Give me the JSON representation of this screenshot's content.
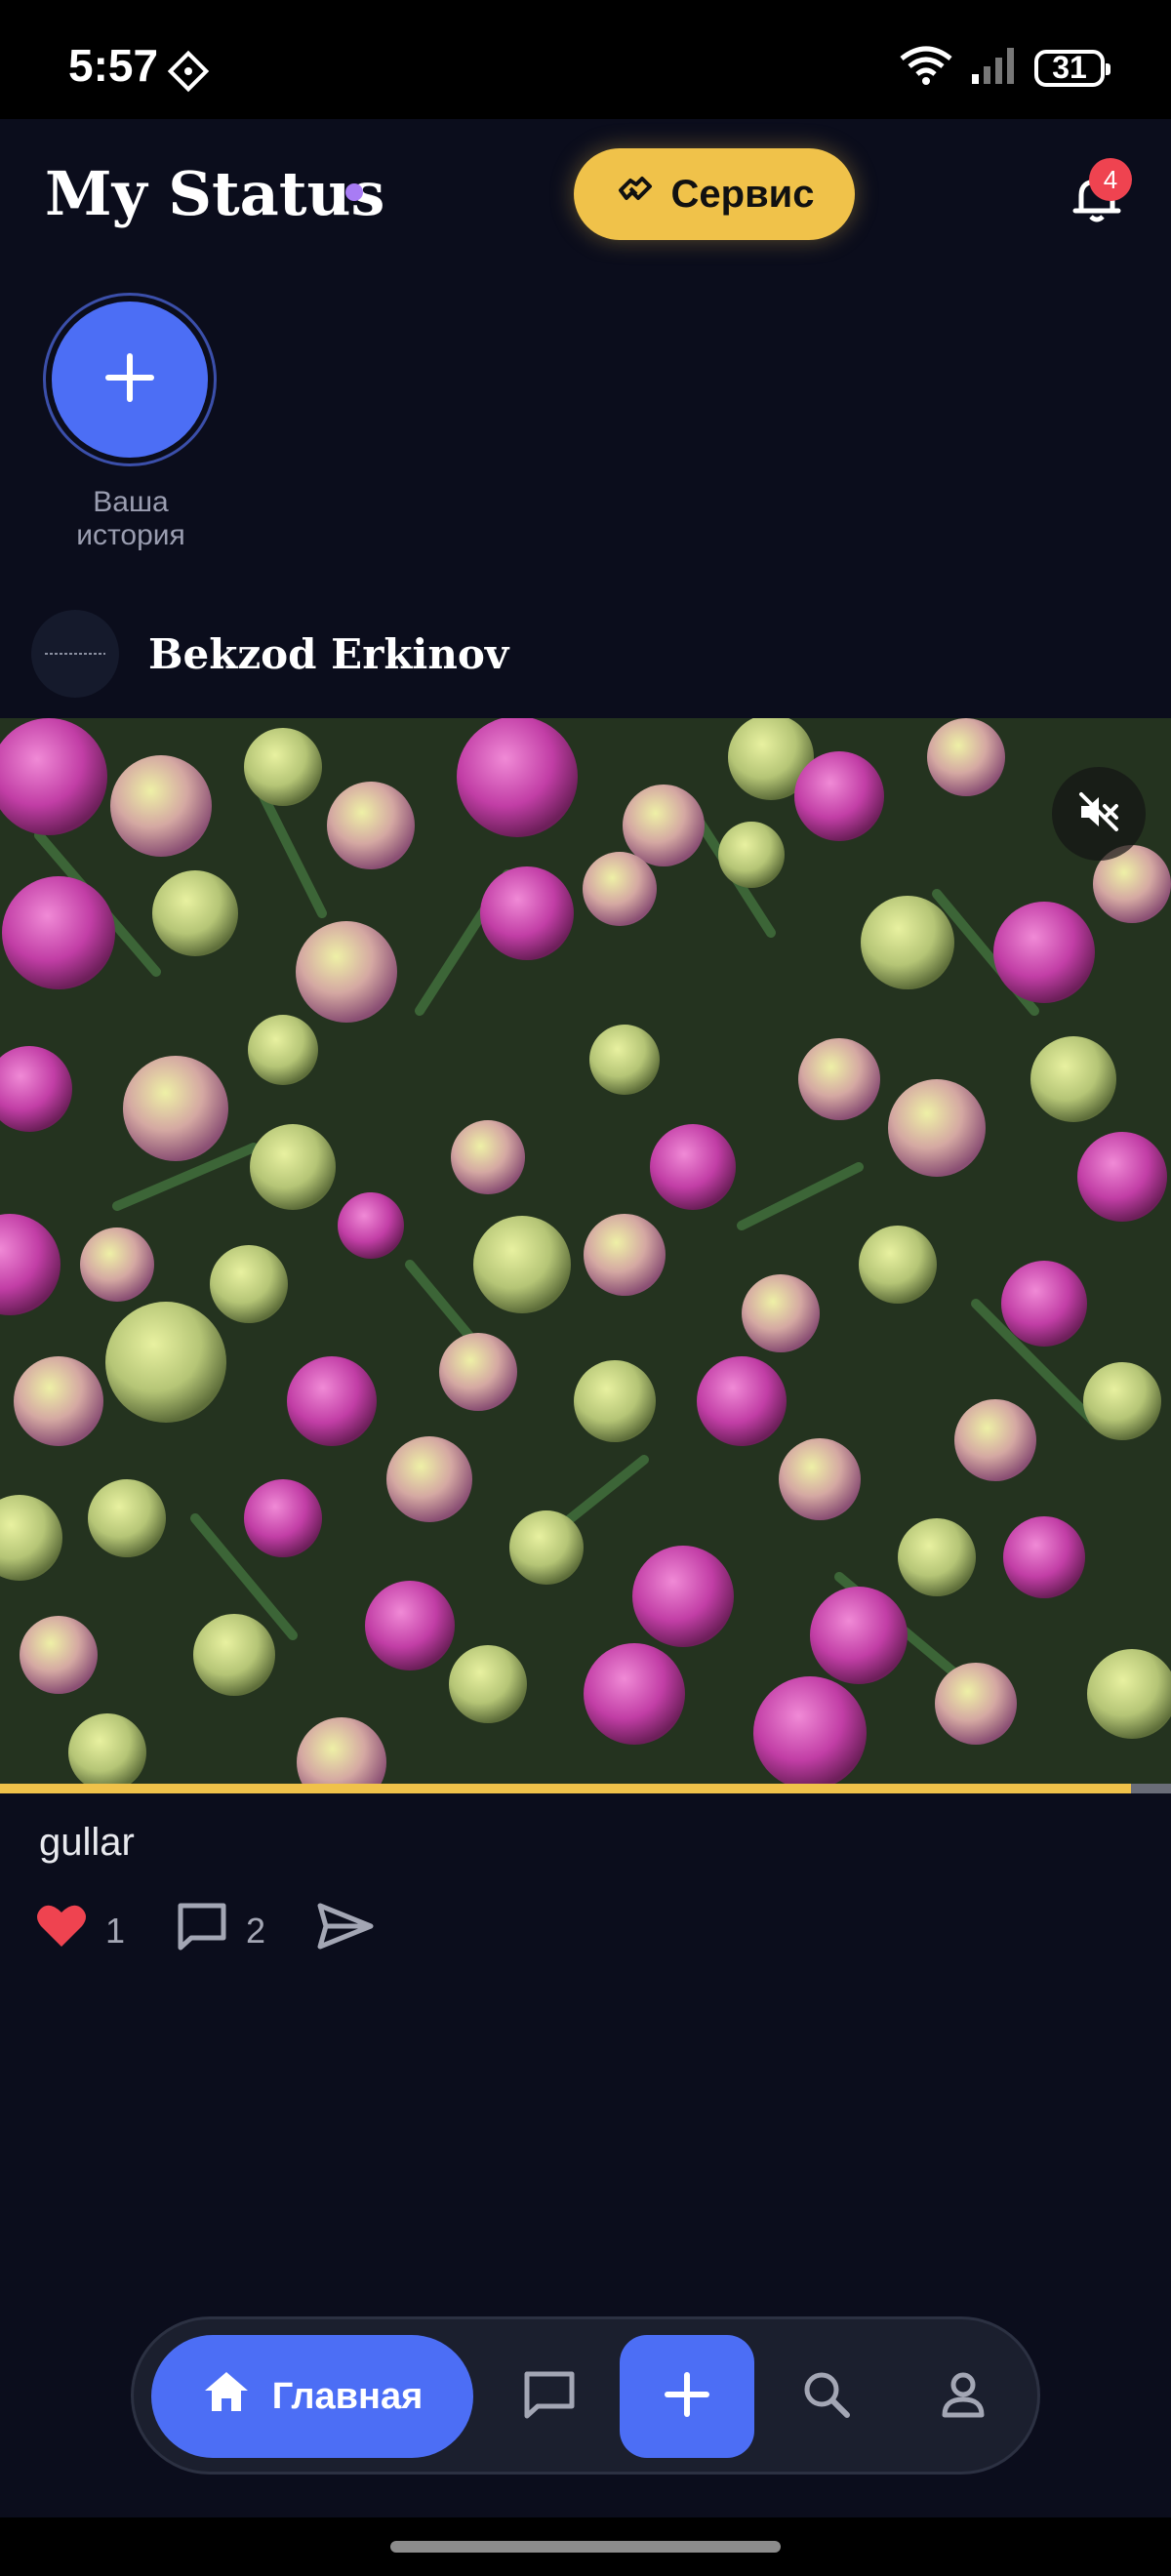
{
  "status_bar": {
    "time": "5:57",
    "battery": "31"
  },
  "header": {
    "title": "My Status",
    "service_label": "Сервис",
    "notification_count": "4"
  },
  "story": {
    "label": "Ваша история"
  },
  "post": {
    "author": "Bekzod Erkinov",
    "caption": "gullar",
    "likes": "1",
    "comments": "2",
    "video_progress": 0.966
  },
  "nav": {
    "home_label": "Главная"
  },
  "colors": {
    "accent": "#4c6ef5",
    "service": "#f0c24a",
    "background": "#0b0d1c",
    "like": "#ef4350"
  }
}
